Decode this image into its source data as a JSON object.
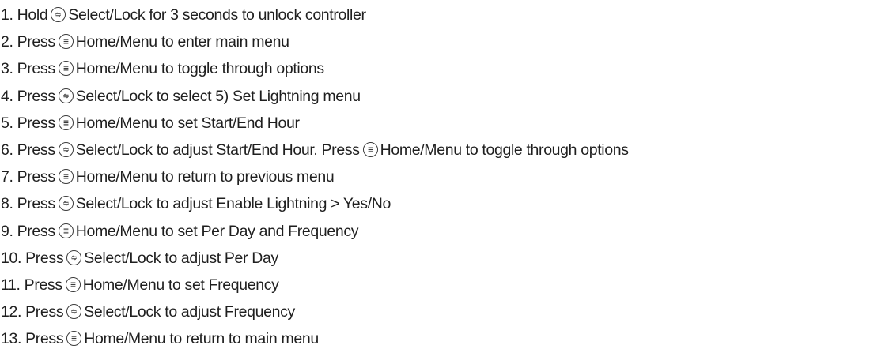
{
  "steps": [
    {
      "parts": [
        {
          "t": "text",
          "v": "1. Hold"
        },
        {
          "t": "icon",
          "icon": "select-lock-icon"
        },
        {
          "t": "text",
          "v": "Select/Lock for 3 seconds to unlock controller"
        }
      ]
    },
    {
      "parts": [
        {
          "t": "text",
          "v": "2. Press"
        },
        {
          "t": "icon",
          "icon": "home-menu-icon"
        },
        {
          "t": "text",
          "v": "Home/Menu to enter main menu"
        }
      ]
    },
    {
      "parts": [
        {
          "t": "text",
          "v": "3. Press"
        },
        {
          "t": "icon",
          "icon": "home-menu-icon"
        },
        {
          "t": "text",
          "v": "Home/Menu to toggle through options"
        }
      ]
    },
    {
      "parts": [
        {
          "t": "text",
          "v": "4. Press"
        },
        {
          "t": "icon",
          "icon": "select-lock-icon"
        },
        {
          "t": "text",
          "v": "Select/Lock to select 5) Set Lightning menu"
        }
      ]
    },
    {
      "parts": [
        {
          "t": "text",
          "v": "5. Press"
        },
        {
          "t": "icon",
          "icon": "home-menu-icon"
        },
        {
          "t": "text",
          "v": "Home/Menu to set Start/End Hour"
        }
      ]
    },
    {
      "parts": [
        {
          "t": "text",
          "v": "6. Press"
        },
        {
          "t": "icon",
          "icon": "select-lock-icon"
        },
        {
          "t": "text",
          "v": "Select/Lock to adjust Start/End Hour. Press"
        },
        {
          "t": "icon",
          "icon": "home-menu-icon"
        },
        {
          "t": "text",
          "v": "Home/Menu to toggle through options"
        }
      ]
    },
    {
      "parts": [
        {
          "t": "text",
          "v": "7. Press"
        },
        {
          "t": "icon",
          "icon": "home-menu-icon"
        },
        {
          "t": "text",
          "v": "Home/Menu to return to previous menu"
        }
      ]
    },
    {
      "parts": [
        {
          "t": "text",
          "v": "8. Press"
        },
        {
          "t": "icon",
          "icon": "select-lock-icon"
        },
        {
          "t": "text",
          "v": "Select/Lock to adjust Enable Lightning > Yes/No"
        }
      ]
    },
    {
      "parts": [
        {
          "t": "text",
          "v": "9. Press"
        },
        {
          "t": "icon",
          "icon": "home-menu-icon"
        },
        {
          "t": "text",
          "v": "Home/Menu to set Per Day and Frequency"
        }
      ]
    },
    {
      "parts": [
        {
          "t": "text",
          "v": "10. Press"
        },
        {
          "t": "icon",
          "icon": "select-lock-icon"
        },
        {
          "t": "text",
          "v": "Select/Lock to adjust Per Day"
        }
      ]
    },
    {
      "parts": [
        {
          "t": "text",
          "v": "11. Press"
        },
        {
          "t": "icon",
          "icon": "home-menu-icon"
        },
        {
          "t": "text",
          "v": "Home/Menu to set Frequency"
        }
      ]
    },
    {
      "parts": [
        {
          "t": "text",
          "v": "12. Press"
        },
        {
          "t": "icon",
          "icon": "select-lock-icon"
        },
        {
          "t": "text",
          "v": "Select/Lock to adjust Frequency"
        }
      ]
    },
    {
      "parts": [
        {
          "t": "text",
          "v": "13. Press"
        },
        {
          "t": "icon",
          "icon": "home-menu-icon"
        },
        {
          "t": "text",
          "v": "Home/Menu to return to main menu"
        }
      ]
    }
  ],
  "colors": {
    "text": "#1f1f1f",
    "icon_stroke": "#3a3a3a",
    "background": "#ffffff"
  }
}
